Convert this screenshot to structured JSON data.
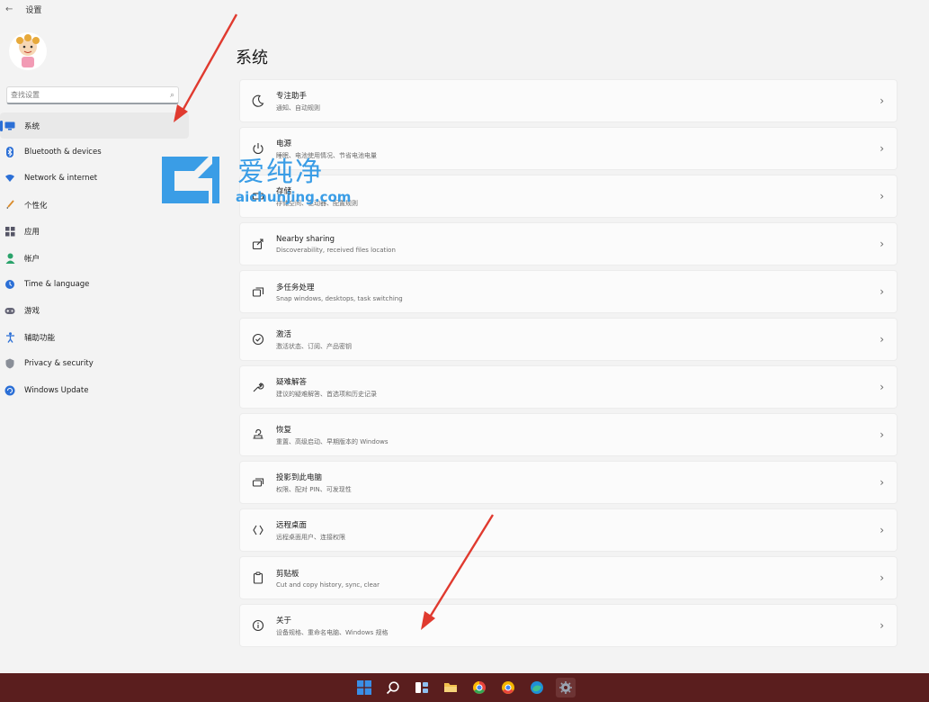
{
  "window": {
    "title": "设置",
    "back_glyph": "←"
  },
  "search": {
    "placeholder": "查找设置"
  },
  "sidebar": {
    "items": [
      {
        "label": "系统",
        "icon": "monitor-icon",
        "color": "#2b6fd6",
        "active": true
      },
      {
        "label": "Bluetooth & devices",
        "icon": "bluetooth-icon",
        "color": "#2b6fd6"
      },
      {
        "label": "Network & internet",
        "icon": "wifi-icon",
        "color": "#2b6fd6"
      },
      {
        "label": "个性化",
        "icon": "brush-icon",
        "color": "#d98b2b"
      },
      {
        "label": "应用",
        "icon": "apps-icon",
        "color": "#556"
      },
      {
        "label": "帐户",
        "icon": "person-icon",
        "color": "#2aa36b"
      },
      {
        "label": "Time & language",
        "icon": "globe-clock-icon",
        "color": "#2b6fd6"
      },
      {
        "label": "游戏",
        "icon": "gamepad-icon",
        "color": "#667"
      },
      {
        "label": "辅助功能",
        "icon": "accessibility-icon",
        "color": "#2b6fd6"
      },
      {
        "label": "Privacy & security",
        "icon": "shield-icon",
        "color": "#777"
      },
      {
        "label": "Windows Update",
        "icon": "update-icon",
        "color": "#2b6fd6"
      }
    ]
  },
  "main": {
    "title": "系统",
    "items": [
      {
        "title": "专注助手",
        "subtitle": "通知、自动规则",
        "icon": "moon-icon"
      },
      {
        "title": "电源",
        "subtitle": "睡眠、电池使用情况、节省电池电量",
        "icon": "power-icon"
      },
      {
        "title": "存储",
        "subtitle": "存储空间、驱动器、配置规则",
        "icon": "storage-icon"
      },
      {
        "title": "Nearby sharing",
        "subtitle": "Discoverability, received files location",
        "icon": "share-icon"
      },
      {
        "title": "多任务处理",
        "subtitle": "Snap windows, desktops, task switching",
        "icon": "multitask-icon"
      },
      {
        "title": "激活",
        "subtitle": "激活状态、订阅、产品密钥",
        "icon": "check-circle-icon"
      },
      {
        "title": "疑难解答",
        "subtitle": "建议的疑难解答、首选项和历史记录",
        "icon": "wrench-icon"
      },
      {
        "title": "恢复",
        "subtitle": "重置、高级启动、早期版本的 Windows",
        "icon": "recovery-icon"
      },
      {
        "title": "投影到此电脑",
        "subtitle": "权限、配对 PIN、可发现性",
        "icon": "projector-icon"
      },
      {
        "title": "远程桌面",
        "subtitle": "远程桌面用户、连接权限",
        "icon": "remote-icon"
      },
      {
        "title": "剪贴板",
        "subtitle": "Cut and copy history, sync, clear",
        "icon": "clipboard-icon"
      },
      {
        "title": "关于",
        "subtitle": "设备规格、重命名电脑、Windows 规格",
        "icon": "info-icon"
      }
    ],
    "chevron": "›"
  },
  "watermark": {
    "text": "爱纯净",
    "url": "aichunjing.com"
  },
  "taskbar": {
    "icons": [
      {
        "name": "start-icon",
        "color": "#3a8ee6"
      },
      {
        "name": "search-icon",
        "color": "#ffffff"
      },
      {
        "name": "task-view-icon",
        "color": "#ffffff"
      },
      {
        "name": "file-explorer-icon",
        "color": "#f2c14e"
      },
      {
        "name": "chrome-icon",
        "color": "#e8453c"
      },
      {
        "name": "chrome-alt-icon",
        "color": "#f4b400"
      },
      {
        "name": "edge-icon",
        "color": "#3fbf8f"
      },
      {
        "name": "settings-icon",
        "color": "#9aa4b2"
      }
    ]
  }
}
